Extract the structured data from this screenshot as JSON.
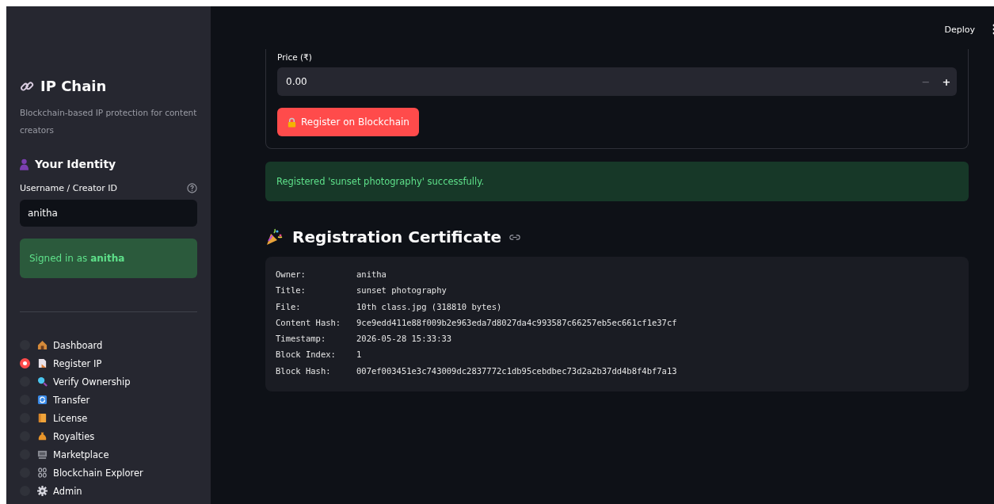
{
  "sidebar": {
    "title": "IP Chain",
    "subtitle": "Blockchain-based IP protection for content creators",
    "identity_heading": "Your Identity",
    "username_label": "Username / Creator ID",
    "username_value": "anitha",
    "signed_in": "Signed in as **anitha**",
    "nav": [
      {
        "label": "Dashboard",
        "selected": false
      },
      {
        "label": "Register IP",
        "selected": true
      },
      {
        "label": "Verify Ownership",
        "selected": false
      },
      {
        "label": "Transfer",
        "selected": false
      },
      {
        "label": "License",
        "selected": false
      },
      {
        "label": "Royalties",
        "selected": false
      },
      {
        "label": "Marketplace",
        "selected": false
      },
      {
        "label": "Blockchain Explorer",
        "selected": false
      },
      {
        "label": "Admin",
        "selected": false
      }
    ]
  },
  "header": {
    "deploy": "Deploy"
  },
  "form": {
    "price_label": "Price (₹)",
    "price_value": "0.00",
    "minus": "−",
    "plus": "+",
    "register_button": "Register on Blockchain"
  },
  "success_message": "Registered 'sunset photography' successfully.",
  "certificate": {
    "heading": "Registration Certificate",
    "rows": [
      {
        "label": "Owner:",
        "value": "anitha"
      },
      {
        "label": "Title:",
        "value": "sunset photography"
      },
      {
        "label": "File:",
        "value": "10th class.jpg (318810 bytes)"
      },
      {
        "label": "Content Hash:",
        "value": "9ce9edd411e88f009b2e963eda7d8027da4c993587c66257eb5ec661cf1e37cf"
      },
      {
        "label": "Timestamp:",
        "value": "2026-05-28 15:33:33"
      },
      {
        "label": "Block Index:",
        "value": "1"
      },
      {
        "label": "Block Hash:",
        "value": "007ef003451e3c743009dc2837772c1db95cebdbec73d2a2b37dd4b8f4bf7a13"
      }
    ]
  }
}
